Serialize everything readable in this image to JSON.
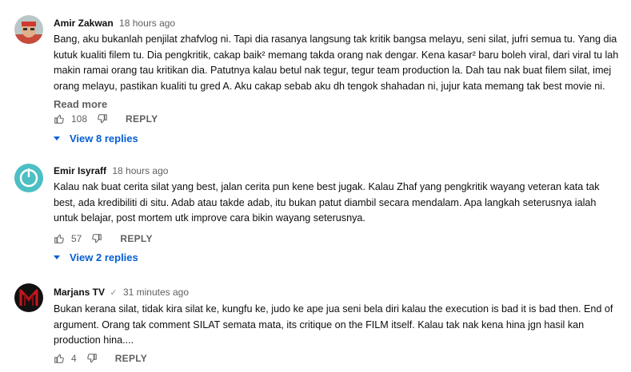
{
  "comments": [
    {
      "author": "Amir Zakwan",
      "time": "18 hours ago",
      "text": "Bang, aku bukanlah penjilat zhafvlog ni. Tapi dia rasanya langsung tak kritik bangsa melayu, seni silat, jufri semua tu. Yang dia kutuk kualiti filem tu. Dia pengkritik, cakap baik² memang takda orang nak dengar. Kena kasar² baru boleh viral, dari viral tu lah makin ramai orang tau kritikan dia. Patutnya kalau betul nak tegur, tegur team production la. Dah tau nak buat filem silat, imej orang melayu, pastikan kualiti tu gred A. Aku cakap sebab aku dh tengok shahadan ni, jujur kata memang tak best movie ni.",
      "read_more": "Read more",
      "likes": "108",
      "reply_label": "REPLY",
      "view_replies": "View 8 replies"
    },
    {
      "author": "Emir Isyraff",
      "time": "18 hours ago",
      "text": "Kalau nak buat cerita silat yang best, jalan cerita pun kene best jugak. Kalau Zhaf yang pengkritik wayang veteran kata tak best, ada kredibiliti di situ. Adab atau takde adab, itu bukan patut diambil secara mendalam. Apa langkah seterusnya ialah untuk belajar, post mortem utk improve cara bikin wayang seterusnya.",
      "likes": "57",
      "reply_label": "REPLY",
      "view_replies": "View 2 replies"
    },
    {
      "author": "Marjans TV",
      "time": "31 minutes ago",
      "verified": "✓",
      "text": "Bukan kerana silat, tidak kira silat ke, kungfu ke, judo ke ape jua seni bela diri kalau the execution is bad it is bad then. End of argument. Orang tak comment SILAT semata mata, its critique on the FILM itself. Kalau tak nak kena hina jgn hasil kan production hina....",
      "likes": "4",
      "reply_label": "REPLY"
    }
  ],
  "colors": {
    "link_blue": "#065fd4",
    "secondary_text": "#606060",
    "avatar2_teal": "#4bbfc4",
    "avatar3_red": "#c4161c"
  }
}
